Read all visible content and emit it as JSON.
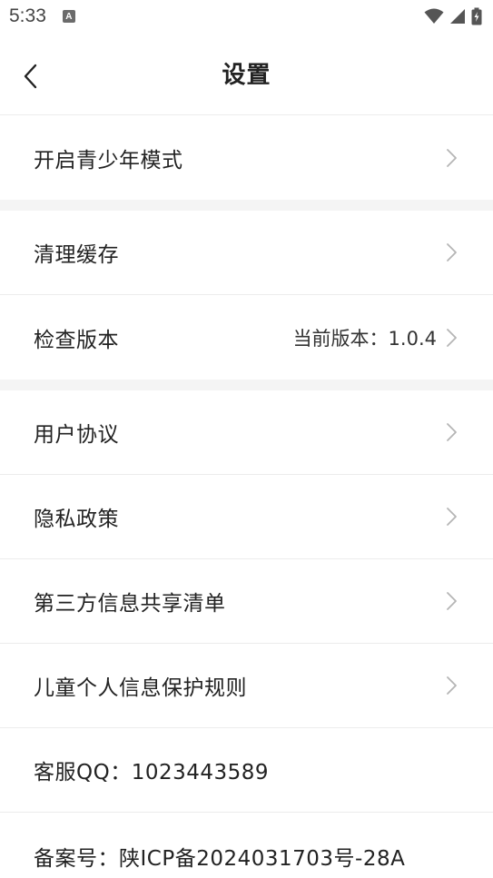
{
  "status_bar": {
    "time": "5:33",
    "notification_glyph": "A",
    "icons": [
      "wifi-icon",
      "signal-icon",
      "battery-charging-icon"
    ]
  },
  "header": {
    "title": "设置",
    "back_icon": "chevron-left-icon"
  },
  "colors": {
    "background": "#ffffff",
    "section_gap": "#f4f4f4",
    "divider": "#ececec",
    "chevron": "#b5b5b5",
    "text": "#222222"
  },
  "settings": {
    "youth_mode": {
      "label": "开启青少年模式"
    },
    "clear_cache": {
      "label": "清理缓存"
    },
    "check_version": {
      "label": "检查版本",
      "value": "当前版本：1.0.4"
    },
    "user_agreement": {
      "label": "用户协议"
    },
    "privacy_policy": {
      "label": "隐私政策"
    },
    "third_party_sharing": {
      "label": "第三方信息共享清单"
    },
    "child_privacy": {
      "label": "儿童个人信息保护规则"
    },
    "customer_service": {
      "label": "客服QQ：1023443589"
    },
    "icp_record": {
      "label": "备案号：陕ICP备2024031703号-28A"
    }
  }
}
